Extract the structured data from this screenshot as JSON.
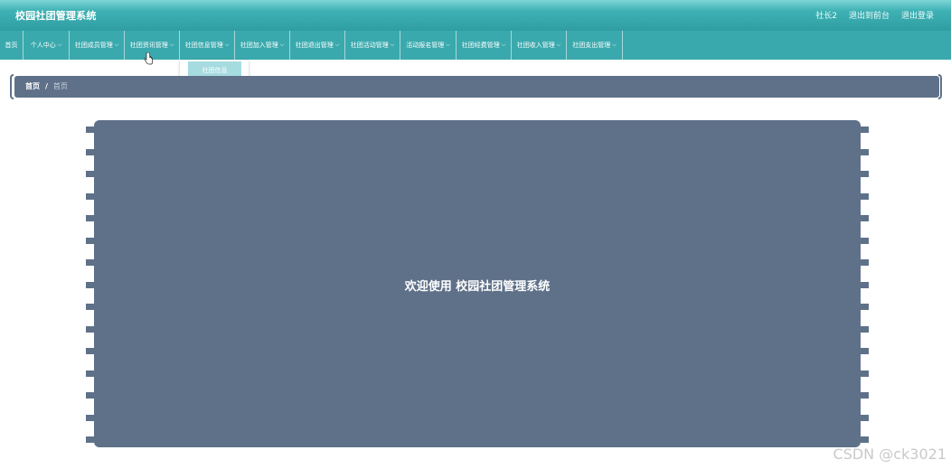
{
  "header": {
    "title": "校园社团管理系统",
    "links": [
      "社长2",
      "退出到前台",
      "退出登录"
    ]
  },
  "nav": {
    "items": [
      {
        "label": "首页",
        "has_menu": false
      },
      {
        "label": "个人中心",
        "has_menu": true
      },
      {
        "label": "社团成员管理",
        "has_menu": true
      },
      {
        "label": "社团资讯管理",
        "has_menu": true
      },
      {
        "label": "社团信息管理",
        "has_menu": true
      },
      {
        "label": "社团加入管理",
        "has_menu": true
      },
      {
        "label": "社团退出管理",
        "has_menu": true
      },
      {
        "label": "社团活动管理",
        "has_menu": true
      },
      {
        "label": "活动报名管理",
        "has_menu": true
      },
      {
        "label": "社团经费管理",
        "has_menu": true
      },
      {
        "label": "社团收入管理",
        "has_menu": true
      },
      {
        "label": "社团支出管理",
        "has_menu": true
      }
    ],
    "dropdown_item": "社团信息"
  },
  "breadcrumb": {
    "home": "首页",
    "separator": "/",
    "current": "首页"
  },
  "main": {
    "welcome": "欢迎使用 校园社团管理系统"
  },
  "watermark": "CSDN @ck3021",
  "colors": {
    "header": "#3fb1b4",
    "nav": "#3aa9ad",
    "panel": "#5f7189"
  }
}
